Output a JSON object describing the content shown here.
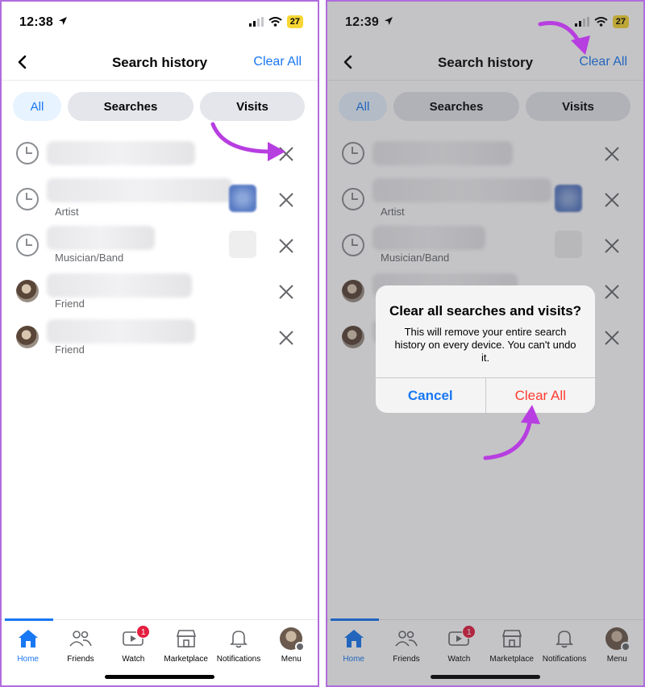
{
  "colors": {
    "accent": "#1877f2",
    "annotation": "#b73ee0",
    "destructive": "#ff3b30",
    "badge": "#e41e3f",
    "frame": "#b06cdc"
  },
  "left": {
    "status": {
      "time": "12:38",
      "battery": "27"
    },
    "header": {
      "title": "Search history",
      "clear_all": "Clear All"
    },
    "tabs": [
      {
        "label": "All",
        "active": true
      },
      {
        "label": "Searches"
      },
      {
        "label": "Visits"
      }
    ],
    "rows": [
      {
        "icon": "clock-icon",
        "subtitle": ""
      },
      {
        "icon": "clock-icon",
        "subtitle": "Artist"
      },
      {
        "icon": "clock-icon",
        "subtitle": "Musician/Band"
      },
      {
        "icon": "avatar",
        "subtitle": "Friend"
      },
      {
        "icon": "avatar",
        "subtitle": "Friend"
      }
    ],
    "nav": [
      {
        "label": "Home",
        "icon": "home-icon",
        "active": true
      },
      {
        "label": "Friends",
        "icon": "friends-icon"
      },
      {
        "label": "Watch",
        "icon": "watch-icon",
        "badge": "1"
      },
      {
        "label": "Marketplace",
        "icon": "marketplace-icon"
      },
      {
        "label": "Notifications",
        "icon": "bell-icon"
      },
      {
        "label": "Menu",
        "icon": "menu-avatar"
      }
    ]
  },
  "right": {
    "status": {
      "time": "12:39",
      "battery": "27"
    },
    "header": {
      "title": "Search history",
      "clear_all": "Clear All"
    },
    "tabs": [
      {
        "label": "All",
        "active": true
      },
      {
        "label": "Searches"
      },
      {
        "label": "Visits"
      }
    ],
    "rows": [
      {
        "icon": "clock-icon",
        "subtitle": ""
      },
      {
        "icon": "clock-icon",
        "subtitle": "Artist"
      },
      {
        "icon": "clock-icon",
        "subtitle": "Musician/Band"
      },
      {
        "icon": "avatar",
        "subtitle": "Friend"
      },
      {
        "icon": "avatar",
        "subtitle": "Friend"
      }
    ],
    "nav": [
      {
        "label": "Home",
        "icon": "home-icon",
        "active": true
      },
      {
        "label": "Friends",
        "icon": "friends-icon"
      },
      {
        "label": "Watch",
        "icon": "watch-icon",
        "badge": "1"
      },
      {
        "label": "Marketplace",
        "icon": "marketplace-icon"
      },
      {
        "label": "Notifications",
        "icon": "bell-icon"
      },
      {
        "label": "Menu",
        "icon": "menu-avatar"
      }
    ],
    "dialog": {
      "title": "Clear all searches and visits?",
      "message": "This will remove your entire search history on every device. You can't undo it.",
      "cancel": "Cancel",
      "confirm": "Clear All"
    }
  }
}
